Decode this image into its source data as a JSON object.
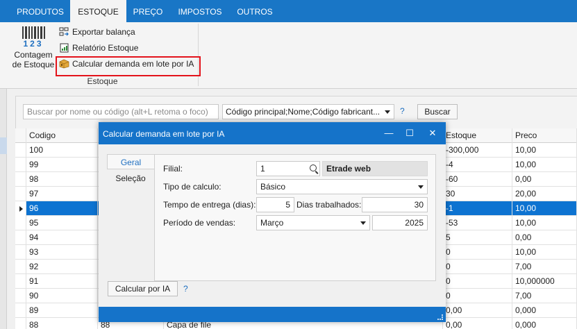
{
  "ribbon": {
    "tabs": [
      {
        "label": "PRODUTOS",
        "active": false
      },
      {
        "label": "ESTOQUE",
        "active": true
      },
      {
        "label": "PREÇO",
        "active": false
      },
      {
        "label": "IMPOSTOS",
        "active": false
      },
      {
        "label": "OUTROS",
        "active": false
      }
    ],
    "big_button": {
      "label_line1": "Contagem",
      "label_line2": "de Estoque",
      "digits": "123"
    },
    "actions": [
      {
        "label": "Exportar balança",
        "icon": "scale-export-icon"
      },
      {
        "label": "Relatório Estoque",
        "icon": "report-icon"
      },
      {
        "label": "Calcular demanda em lote por IA",
        "icon": "ai-box-icon"
      }
    ],
    "group_label": "Estoque"
  },
  "search": {
    "placeholder": "Buscar por nome ou código (alt+L retoma o foco)",
    "fields_combo": "Código principal;Nome;Código fabricant...",
    "help": "?",
    "button": "Buscar"
  },
  "grid": {
    "columns": {
      "codigo": "Codigo",
      "estoque": "Estoque",
      "preco": "Preco"
    },
    "rows": [
      {
        "codigo": "100",
        "estoque": "-300,000",
        "preco": "10,00"
      },
      {
        "codigo": "99",
        "estoque": "-4",
        "preco": "10,00"
      },
      {
        "codigo": "98",
        "estoque": "-60",
        "preco": "0,00"
      },
      {
        "codigo": "97",
        "estoque": "30",
        "preco": "20,00"
      },
      {
        "codigo": "96",
        "estoque": "-1",
        "preco": "10,00",
        "selected": true
      },
      {
        "codigo": "95",
        "estoque": "-53",
        "preco": "10,00"
      },
      {
        "codigo": "94",
        "estoque": "5",
        "preco": "0,00"
      },
      {
        "codigo": "93",
        "estoque": "0",
        "preco": "10,00"
      },
      {
        "codigo": "92",
        "estoque": "0",
        "preco": "7,00"
      },
      {
        "codigo": "91",
        "estoque": "0",
        "preco": "10,000000"
      },
      {
        "codigo": "90",
        "estoque": "0",
        "preco": "7,00"
      },
      {
        "codigo": "89",
        "estoque": "0,00",
        "preco": "0,000"
      },
      {
        "codigo": "88",
        "col2": "88",
        "nome": "Capa de file",
        "estoque": "0,00",
        "preco": "0,000"
      }
    ]
  },
  "dialog": {
    "title": "Calcular demanda em lote por IA",
    "controls": {
      "minimize": "—",
      "maximize": "☐",
      "close": "✕"
    },
    "tabs": [
      {
        "label": "Geral",
        "active": true
      },
      {
        "label": "Seleção",
        "active": false
      }
    ],
    "labels": {
      "filial": "Filial:",
      "tipo": "Tipo de calculo:",
      "tempo": "Tempo de entrega (dias):",
      "dias": "Dias trabalhados:",
      "periodo": "Período de vendas:"
    },
    "values": {
      "filial": "1",
      "filial_nome": "Etrade web",
      "tipo": "Básico",
      "tempo": "5",
      "dias": "30",
      "mes": "Março",
      "ano": "2025"
    },
    "calc_button": "Calcular por IA",
    "help": "?"
  }
}
